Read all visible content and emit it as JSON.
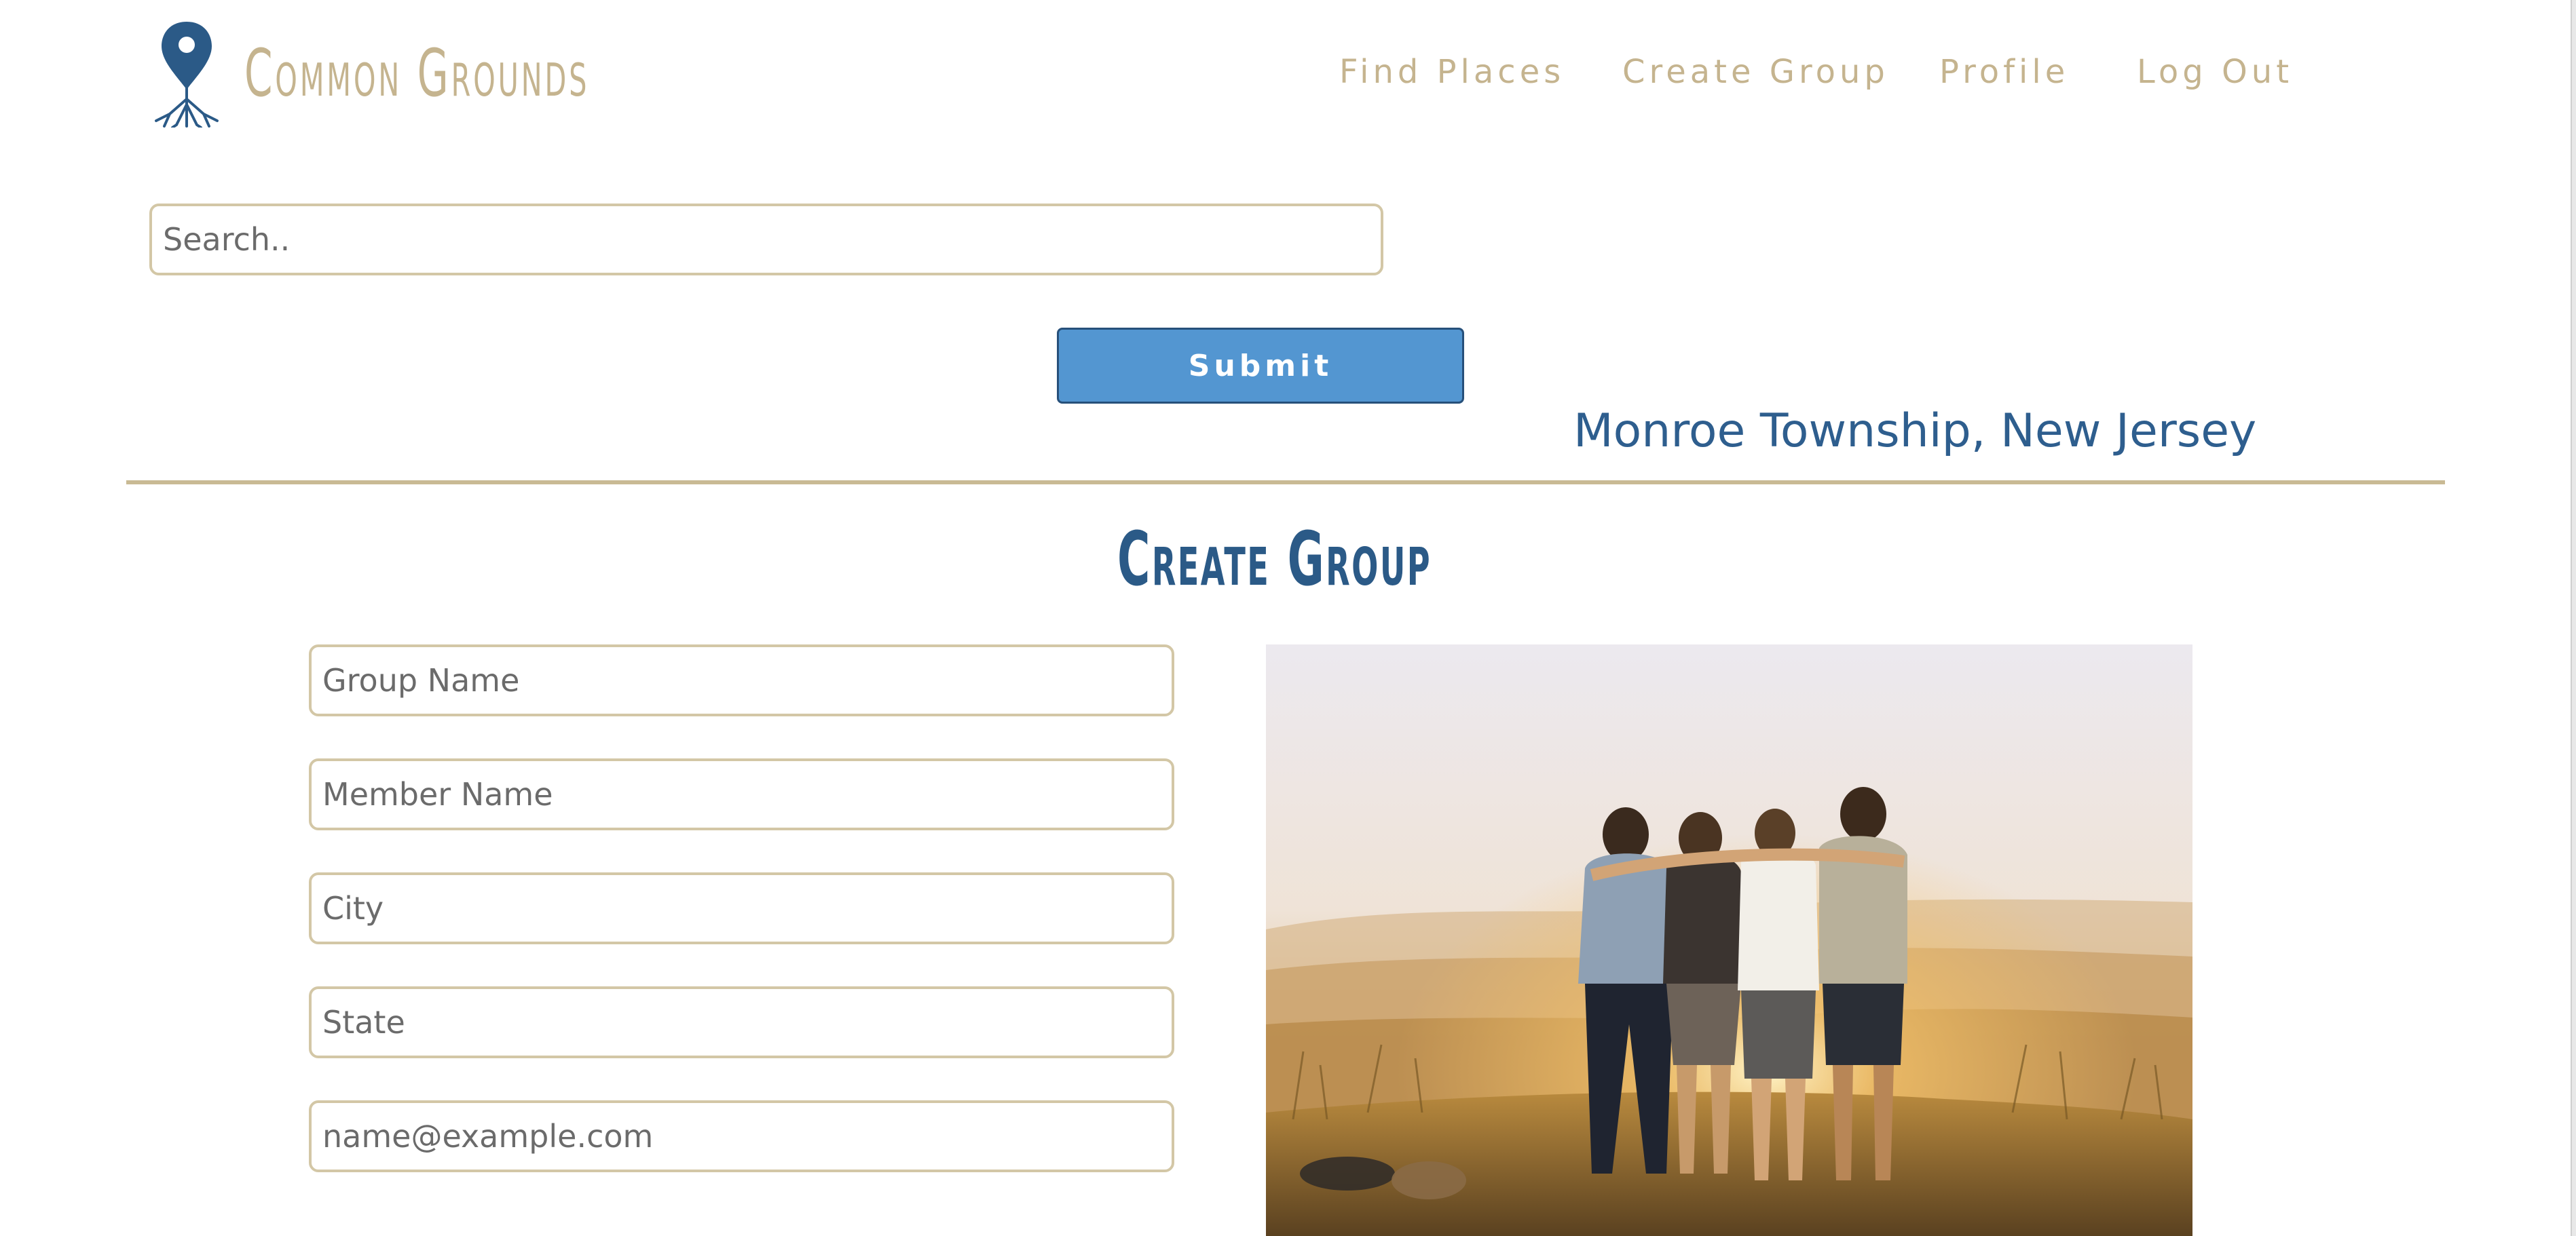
{
  "header": {
    "brand": "Common Grounds",
    "logo_icon": "map-pin-roots-icon",
    "nav": [
      {
        "label": "Find Places"
      },
      {
        "label": "Create Group"
      },
      {
        "label": "Profile"
      },
      {
        "label": "Log Out"
      }
    ]
  },
  "search": {
    "placeholder": "Search..",
    "submit_label": "Submit"
  },
  "location": "Monroe Township, New Jersey",
  "create_group": {
    "title": "Create Group",
    "fields": [
      {
        "placeholder": "Group Name"
      },
      {
        "placeholder": "Member Name"
      },
      {
        "placeholder": "City"
      },
      {
        "placeholder": "State"
      },
      {
        "placeholder": "name@example.com"
      }
    ],
    "photo_icon": "group-of-friends-sunset-photo"
  },
  "colors": {
    "brand_tan": "#c5b48f",
    "field_border": "#d3c7a6",
    "accent_blue": "#2e5e8e",
    "button_blue": "#5396d1",
    "divider": "#c9ba94"
  }
}
